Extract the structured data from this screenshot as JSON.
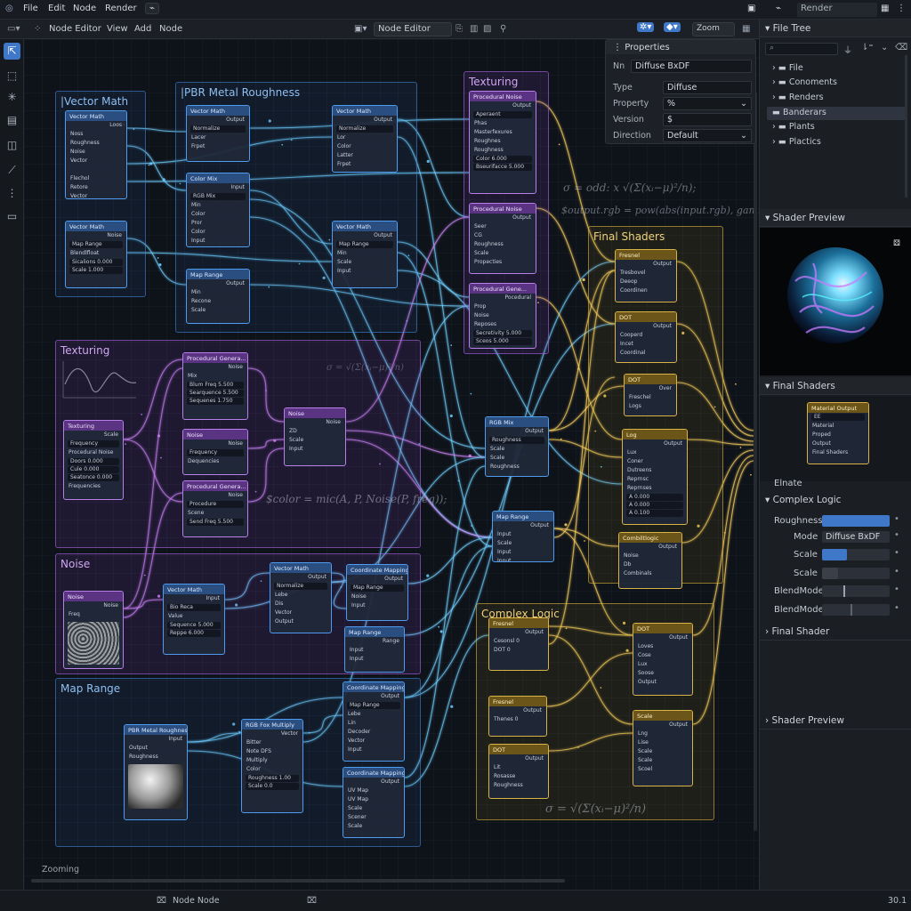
{
  "topbar": {
    "menus": [
      "File",
      "Edit",
      "Node",
      "Render"
    ],
    "right_label": "Render"
  },
  "header": {
    "editor_type": "Node Editor",
    "menus": [
      "View",
      "Add",
      "Node"
    ],
    "center_dropdown": "Node Editor",
    "zoom": "Zoom"
  },
  "properties": {
    "title": "Properties",
    "name_key": "Nn",
    "name_value": "Diffuse BxDF",
    "rows": [
      {
        "label": "Type",
        "value": "Diffuse"
      },
      {
        "label": "Property",
        "value": "%"
      },
      {
        "label": "Version",
        "value": "$"
      },
      {
        "label": "Direction",
        "value": "Default"
      }
    ]
  },
  "file_tree": {
    "title": "File Tree",
    "items": [
      "File",
      "Conoments",
      "Renders",
      "Banderars",
      "Plants",
      "Plactics"
    ]
  },
  "shader_preview": {
    "title": "Shader Preview"
  },
  "final_shaders_panel": {
    "title": "Final Shaders"
  },
  "elnate": "Elnate",
  "complex_logic_panel": {
    "title": "Complex Logic",
    "rows": [
      {
        "label": "Roughness",
        "value": ""
      },
      {
        "label": "Mode",
        "value": "Diffuse BxDF"
      },
      {
        "label": "Scale",
        "value": ""
      },
      {
        "label": "Scale",
        "value": ""
      },
      {
        "label": "BlendMode",
        "value": ""
      },
      {
        "label": "BlendMode",
        "value": ""
      }
    ]
  },
  "bottom_panels": [
    "Final Shader",
    "Shader Preview"
  ],
  "frames": {
    "vector_math": "|Vector Math",
    "pbr": "|PBR Metal Roughness",
    "texturing_top": "Texturing",
    "final_shaders": "Final Shaders",
    "texturing": "Texturing",
    "noise": "Noise",
    "map_range": "Map Range",
    "complex_logic": "Complex Logic"
  },
  "math": {
    "m1": "σ = odd: x √(Σ(xᵢ−μ)²/n);",
    "m2": "$output.rgb = pow(abs(input.rgb), gamma);",
    "m3": "$color = mic(A, P, Noise(P, freq));",
    "m4": "σ = √(Σ(xᵢ−μ)²/n)",
    "m5": "σ = √(Σ(xᵢ−μ)²/n)"
  },
  "editor_status": "Zooming",
  "status": {
    "center": "Node Node",
    "version": "30.1"
  },
  "colors": {
    "blue": "#4e9cf0",
    "purple": "#b77fe8",
    "gold": "#d9b347",
    "accent": "#3f78c8"
  },
  "nodes": {
    "vm1": {
      "title": "Vector Math",
      "rows": [
        "Loos",
        "Noss",
        "Roughness",
        "Noise",
        "Vector",
        "",
        "Flechol",
        "Retore",
        "Vector"
      ]
    },
    "vm2": {
      "title": "Vector Math",
      "rows": [
        "Noise",
        "Map Range",
        "Blendlfloat",
        "Sicalions  0.000",
        "Scale  1.000"
      ]
    },
    "pb1": {
      "title": "Vector Math",
      "rows": [
        "Output",
        "Normalize",
        "Lacer",
        "Frpet"
      ]
    },
    "pb2": {
      "title": "Vector Math",
      "rows": [
        "Output",
        "Normalize",
        "Lor",
        "Color",
        "Latter",
        "Frpet"
      ]
    },
    "pb3": {
      "title": "Color Mix",
      "rows": [
        "Input",
        "RGB Mix",
        "Min",
        "Color",
        "Pror",
        "Color",
        "Input"
      ]
    },
    "pb4": {
      "title": "Vector Math",
      "rows": [
        "Output",
        "Map Range",
        "Min",
        "Scale",
        "Input"
      ]
    },
    "pb5": {
      "title": "Map Range",
      "rows": [
        "Output",
        "Min",
        "Recone",
        "Scale"
      ]
    },
    "tt1": {
      "title": "Procedural Noise",
      "rows": [
        "Output",
        "Aperaent",
        "Phas",
        "Masterfexures",
        "Roughnes",
        "Roughness",
        "Color  6.000",
        "Bseurifacce  5.000"
      ]
    },
    "tt2": {
      "title": "Procedural Noise",
      "rows": [
        "Output",
        "Seer",
        "CG",
        "Roughness",
        "Scale",
        "Propecties"
      ]
    },
    "tt3": {
      "title": "Procedural Gene...",
      "rows": [
        "Pocedural",
        "Prop",
        "Noise",
        "Reposes",
        "Secretivity  5.000",
        "Sceos  5.000"
      ]
    },
    "tx1": {
      "title": "Texturing",
      "rows": [
        "Scale",
        "Frequency",
        "Procedural Noise",
        "Doors  0.000",
        "Cule  0.000",
        "Seatonce  0.000",
        "Frequencies"
      ]
    },
    "tx2": {
      "title": "Procedural Genera...",
      "rows": [
        "Noise",
        "Mix",
        "Blum Freq  5.500",
        "Searquence  5.500",
        "Sequenes  1.750"
      ]
    },
    "tx3": {
      "title": "Noise",
      "rows": [
        "Noise",
        "Frequency",
        "Dequencies"
      ]
    },
    "tx4": {
      "title": "Noise",
      "rows": [
        "Noise",
        "ZD",
        "Scale",
        "Input"
      ]
    },
    "tx5": {
      "title": "Procedural Genera...",
      "rows": [
        "Noise",
        "Procedure",
        "Scene",
        "Send Freq  5.500"
      ]
    },
    "nz1": {
      "title": "Noise",
      "rows": [
        "Noise",
        "Freq"
      ]
    },
    "nz2": {
      "title": "Vector Math",
      "rows": [
        "Input",
        "Bio Reca",
        "Value",
        "Sequence  5.000",
        "Reppe  6.000"
      ]
    },
    "nz3": {
      "title": "Vector Math",
      "rows": [
        "Output",
        "Normalize",
        "Lebe",
        "Dis",
        "Vector",
        "Output"
      ]
    },
    "nz4": {
      "title": "Coordinate Mapping",
      "rows": [
        "Output",
        "Map Range",
        "Noise",
        "Input"
      ]
    },
    "nz5": {
      "title": "Map Range",
      "rows": [
        "Range",
        "Input",
        "Input"
      ]
    },
    "mp1": {
      "title": "PBR Metal Roughness",
      "rows": [
        "Input",
        "Output",
        "Roughness"
      ]
    },
    "mp2": {
      "title": "RGB Fox Multiply",
      "rows": [
        "Vector",
        "Bitter",
        "Note  DFS",
        "Multiply",
        "Color",
        "Roughness  1.00",
        "Scale  0.0"
      ]
    },
    "mp3": {
      "title": "Coordinate Mapping",
      "rows": [
        "Output",
        "Map Range",
        "Lebe",
        "Lin",
        "Decoder",
        "Vector",
        "Input"
      ]
    },
    "mp4": {
      "title": "Coordinate Mapping",
      "rows": [
        "Output",
        "UV Map",
        "UV Map",
        "Scale",
        "Scener",
        "Scale"
      ]
    },
    "mc1": {
      "title": "RGB Mix",
      "rows": [
        "Output",
        "Roughness",
        "Scale",
        "Scale",
        "Roughness"
      ]
    },
    "mc2": {
      "title": "Map Range",
      "rows": [
        "Output",
        "Input",
        "Scale",
        "Input",
        "Input"
      ]
    },
    "fs1": {
      "title": "Fresnel",
      "rows": [
        "Output",
        "Tresbovel",
        "Deeop",
        "Coordinen"
      ]
    },
    "fs2": {
      "title": "DOT",
      "rows": [
        "Output",
        "Cooperd",
        "Incet",
        "Coordinal"
      ]
    },
    "fs3": {
      "title": "DOT",
      "rows": [
        "Over",
        "Freschel",
        "Logs"
      ]
    },
    "fs4": {
      "title": "Log",
      "rows": [
        "Output",
        "Lux",
        "Coner",
        "Dutreens",
        "Reprnsc",
        "Reprnses",
        "A  0.000",
        "A  0.000",
        "A  0.100"
      ]
    },
    "fs5": {
      "title": "Combiltlogic",
      "rows": [
        "Output",
        "Noise",
        "Db",
        "Combinals"
      ]
    },
    "mo": {
      "title": "Material Output",
      "rows": [
        "EE",
        "Material",
        "Proped",
        "Output",
        "Final Shaders"
      ]
    },
    "cl1": {
      "title": "Fresnel",
      "rows": [
        "Output",
        "Cesonsl  0",
        "DOT  0"
      ]
    },
    "cl2": {
      "title": "Fresnel",
      "rows": [
        "Output",
        "Thenes  0"
      ]
    },
    "cl3": {
      "title": "DOT",
      "rows": [
        "Output",
        "Lit",
        "Rosasse",
        "Roughness"
      ]
    },
    "cl4": {
      "title": "DOT",
      "rows": [
        "Output",
        "Loves",
        "Cose",
        "Lux",
        "Soose",
        "Output"
      ]
    },
    "cl5": {
      "title": "Scale",
      "rows": [
        "Output",
        "Lng",
        "Lise",
        "Scale",
        "Scale",
        "Scoel"
      ]
    }
  }
}
